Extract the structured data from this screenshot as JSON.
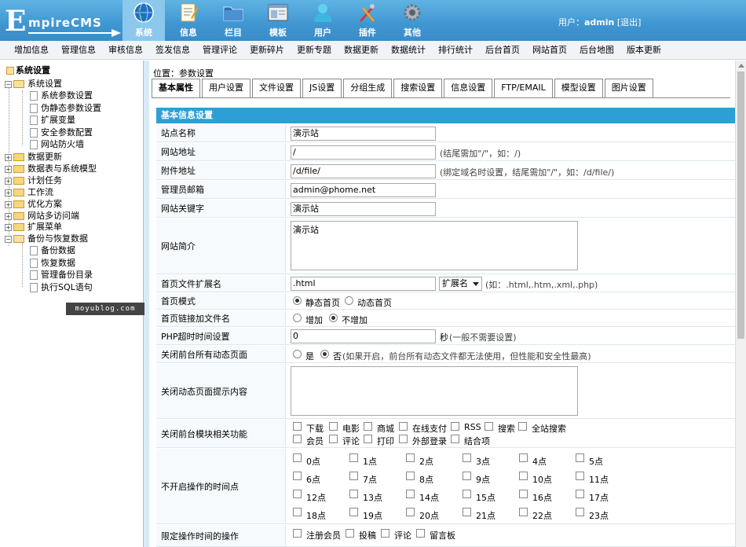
{
  "header": {
    "logo_first": "E",
    "logo_rest": "mpireCMS",
    "nav": [
      {
        "label": "系统",
        "icon": "globe-icon",
        "active": true
      },
      {
        "label": "信息",
        "icon": "notepad-icon"
      },
      {
        "label": "栏目",
        "icon": "folder-icon"
      },
      {
        "label": "模板",
        "icon": "window-icon"
      },
      {
        "label": "用户",
        "icon": "user-icon"
      },
      {
        "label": "插件",
        "icon": "tools-icon"
      },
      {
        "label": "其他",
        "icon": "gear-icon"
      }
    ],
    "user_prefix": "用户：",
    "user_name": "admin",
    "logout": "[退出]"
  },
  "submenu": [
    "增加信息",
    "管理信息",
    "审核信息",
    "签发信息",
    "管理评论",
    "更新碎片",
    "更新专题",
    "数据更新",
    "数据统计",
    "排行统计",
    "后台首页",
    "网站首页",
    "后台地图",
    "版本更新"
  ],
  "sidebar": {
    "root": "系统设置",
    "items": [
      {
        "label": "系统设置",
        "type": "folder-open"
      },
      {
        "label": "系统参数设置",
        "type": "doc"
      },
      {
        "label": "伪静态参数设置",
        "type": "doc"
      },
      {
        "label": "扩展变量",
        "type": "doc"
      },
      {
        "label": "安全参数配置",
        "type": "doc"
      },
      {
        "label": "网站防火墙",
        "type": "doc"
      },
      {
        "label": "数据更新",
        "type": "folder"
      },
      {
        "label": "数据表与系统模型",
        "type": "folder"
      },
      {
        "label": "计划任务",
        "type": "folder"
      },
      {
        "label": "工作流",
        "type": "folder"
      },
      {
        "label": "优化方案",
        "type": "folder"
      },
      {
        "label": "网站多访问端",
        "type": "folder"
      },
      {
        "label": "扩展菜单",
        "type": "folder"
      },
      {
        "label": "备份与恢复数据",
        "type": "folder-open"
      },
      {
        "label": "备份数据",
        "type": "doc"
      },
      {
        "label": "恢复数据",
        "type": "doc"
      },
      {
        "label": "管理备份目录",
        "type": "doc"
      },
      {
        "label": "执行SQL语句",
        "type": "doc"
      }
    ],
    "watermark": "moyublog.com"
  },
  "main": {
    "breadcrumb_prefix": "位置：",
    "breadcrumb_link": "参数设置",
    "tabs": [
      "基本属性",
      "用户设置",
      "文件设置",
      "JS设置",
      "分组生成",
      "搜索设置",
      "信息设置",
      "FTP/EMAIL",
      "模型设置",
      "图片设置"
    ],
    "section_title": "基本信息设置",
    "site_name_label": "站点名称",
    "site_name": "演示站",
    "site_url_label": "网站地址",
    "site_url": "/",
    "site_url_hint": "(结尾需加\"/\"，如：/)",
    "attach_url_label": "附件地址",
    "attach_url": "/d/file/",
    "attach_url_hint": "(绑定域名时设置，结尾需加\"/\"，如：/d/file/)",
    "admin_email_label": "管理员邮箱",
    "admin_email": "admin@phome.net",
    "keywords_label": "网站关键字",
    "keywords": "演示站",
    "intro_label": "网站简介",
    "intro": "演示站",
    "index_ext_label": "首页文件扩展名",
    "index_ext": ".html",
    "ext_select": "扩展名",
    "index_ext_hint": "(如：.html,.htm,.xml,.php)",
    "index_mode_label": "首页模式",
    "index_mode_static": "静态首页",
    "index_mode_dynamic": "动态首页",
    "index_link_label": "首页链接加文件名",
    "index_link_add": "增加",
    "index_link_noadd": "不增加",
    "php_timeout_label": "PHP超时时间设置",
    "php_timeout": "0",
    "php_timeout_unit": "秒",
    "php_timeout_hint": "(一般不需要设置)",
    "close_dynamic_label": "关闭前台所有动态页面",
    "close_yes": "是",
    "close_no": "否",
    "close_hint": "(如果开启，前台所有动态文件都无法使用，但性能和安全性最高)",
    "close_tip_label": "关闭动态页面提示内容",
    "close_modules_label": "关闭前台模块相关功能",
    "modules_row1": [
      "下载",
      "电影",
      "商城",
      "在线支付",
      "RSS",
      "搜索",
      "全站搜索"
    ],
    "modules_row2": [
      "会员",
      "评论",
      "打印",
      "外部登录",
      "结合项"
    ],
    "hours_label": "不开启操作的时间点",
    "hours": [
      "0点",
      "1点",
      "2点",
      "3点",
      "4点",
      "5点",
      "6点",
      "7点",
      "8点",
      "9点",
      "10点",
      "11点",
      "12点",
      "13点",
      "14点",
      "15点",
      "16点",
      "17点",
      "18点",
      "19点",
      "20点",
      "21点",
      "22点",
      "23点"
    ],
    "limit_label": "限定操作时间的操作",
    "limit_items": [
      "注册会员",
      "投稿",
      "评论",
      "留言板"
    ]
  },
  "colors": {
    "header": "#3f96d1",
    "section": "#2d9fd6",
    "nav_active": "#8cc8ec"
  }
}
